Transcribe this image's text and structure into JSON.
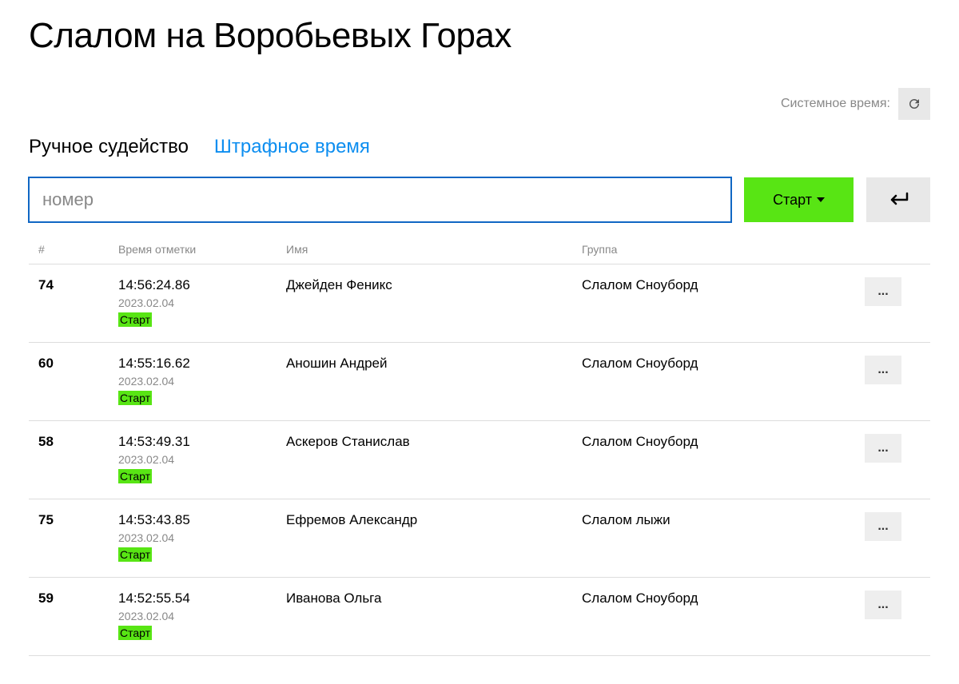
{
  "page_title": "Слалом на Воробьевых Горах",
  "system_time_label": "Системное время:",
  "tabs": {
    "manual": "Ручное судейство",
    "penalty": "Штрафное время"
  },
  "input": {
    "placeholder": "номер"
  },
  "start_button": "Старт",
  "table": {
    "headers": {
      "num": "#",
      "time": "Время отметки",
      "name": "Имя",
      "group": "Группа"
    },
    "rows": [
      {
        "num": "74",
        "time": "14:56:24.86",
        "date": "2023.02.04",
        "badge": "Старт",
        "name": "Джейден Феникс",
        "group": "Слалом Сноуборд"
      },
      {
        "num": "60",
        "time": "14:55:16.62",
        "date": "2023.02.04",
        "badge": "Старт",
        "name": "Аношин Андрей",
        "group": "Слалом Сноуборд"
      },
      {
        "num": "58",
        "time": "14:53:49.31",
        "date": "2023.02.04",
        "badge": "Старт",
        "name": "Аскеров Станислав",
        "group": "Слалом Сноуборд"
      },
      {
        "num": "75",
        "time": "14:53:43.85",
        "date": "2023.02.04",
        "badge": "Старт",
        "name": "Ефремов Александр",
        "group": "Слалом лыжи"
      },
      {
        "num": "59",
        "time": "14:52:55.54",
        "date": "2023.02.04",
        "badge": "Старт",
        "name": "Иванова Ольга",
        "group": "Слалом Сноуборд"
      }
    ]
  },
  "more_label": "..."
}
